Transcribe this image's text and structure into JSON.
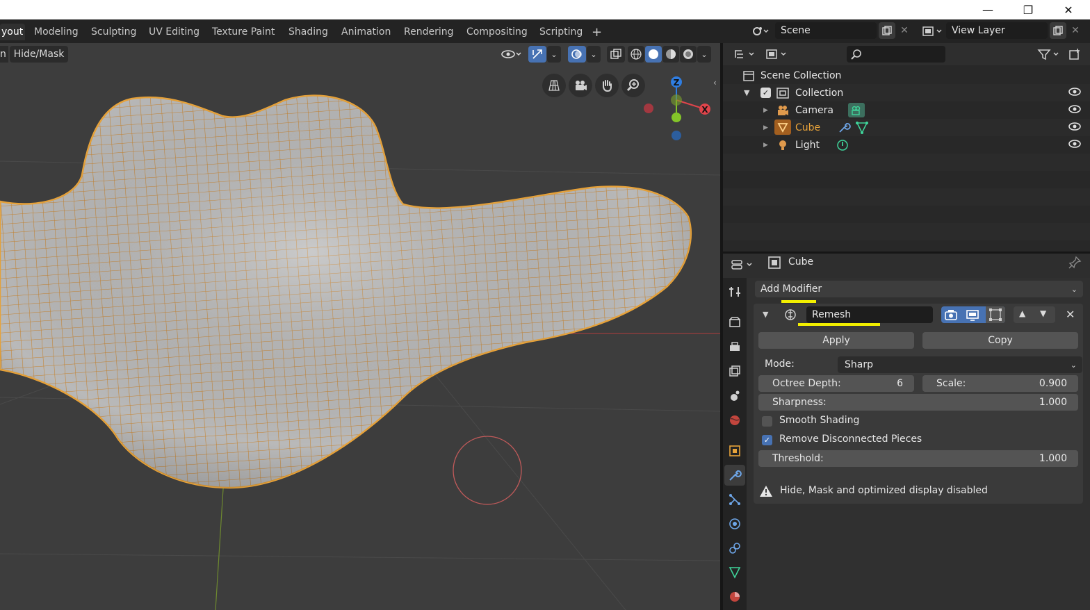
{
  "titlebar": {
    "minimize": "—",
    "maximize": "❐",
    "close": "✕"
  },
  "workspaces": {
    "tabs": [
      "yout",
      "Modeling",
      "Sculpting",
      "UV Editing",
      "Texture Paint",
      "Shading",
      "Animation",
      "Rendering",
      "Compositing",
      "Scripting"
    ],
    "add": "+"
  },
  "scene": {
    "name": "Scene",
    "view_layer": "View Layer"
  },
  "viewport": {
    "menu_left": "n",
    "menu_hide_mask": "Hide/Mask",
    "gizmo": {
      "z": "Z",
      "x": "X"
    }
  },
  "outliner": {
    "scene_collection": "Scene Collection",
    "collection": "Collection",
    "items": [
      {
        "label": "Camera"
      },
      {
        "label": "Cube"
      },
      {
        "label": "Light"
      }
    ]
  },
  "properties": {
    "object_name": "Cube",
    "add_modifier": "Add Modifier",
    "modifier_name": "Remesh",
    "apply": "Apply",
    "copy": "Copy",
    "mode_label": "Mode:",
    "mode_value": "Sharp",
    "octree_label": "Octree Depth:",
    "octree_value": "6",
    "scale_label": "Scale:",
    "scale_value": "0.900",
    "sharpness_label": "Sharpness:",
    "sharpness_value": "1.000",
    "smooth_shading": "Smooth Shading",
    "remove_disconnected": "Remove Disconnected Pieces",
    "threshold_label": "Threshold:",
    "threshold_value": "1.000",
    "warning": "Hide, Mask and optimized display disabled"
  },
  "colors": {
    "accent": "#4772b3",
    "selected": "#e8a33a",
    "highlight": "#f2ef00"
  }
}
